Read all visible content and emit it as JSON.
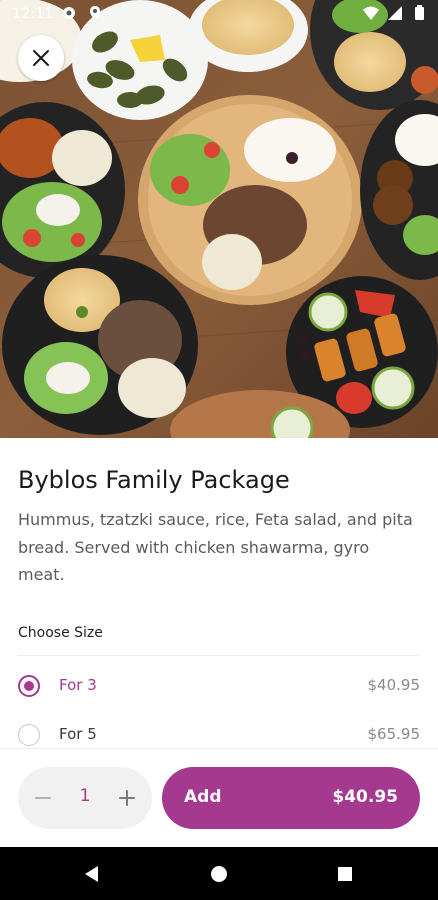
{
  "status_bar": {
    "time": "12:11",
    "icons": [
      "settings-icon",
      "location-icon",
      "wifi-icon",
      "signal-icon",
      "battery-icon"
    ]
  },
  "hero": {
    "image": "mediterranean-platters-photo",
    "close_icon": "close-icon"
  },
  "item": {
    "title": "Byblos Family Package",
    "description": "Hummus, tzatzki sauce, rice, Feta salad, and pita bread. Served with chicken shawarma, gyro meat."
  },
  "size_section": {
    "label": "Choose Size",
    "options": [
      {
        "label": "For 3",
        "price": "$40.95",
        "selected": true
      },
      {
        "label": "For 5",
        "price": "$65.95",
        "selected": false
      }
    ]
  },
  "quantity": {
    "value": "1",
    "minus_icon": "minus-icon",
    "plus_icon": "plus-icon"
  },
  "add_button": {
    "label": "Add",
    "price": "$40.95"
  },
  "nav": {
    "icons": [
      "back-icon",
      "home-icon",
      "recents-icon"
    ]
  },
  "colors": {
    "accent": "#a5398f",
    "text": "#1b1b1b",
    "muted": "#5b5b5b",
    "navbar": "#000000"
  }
}
